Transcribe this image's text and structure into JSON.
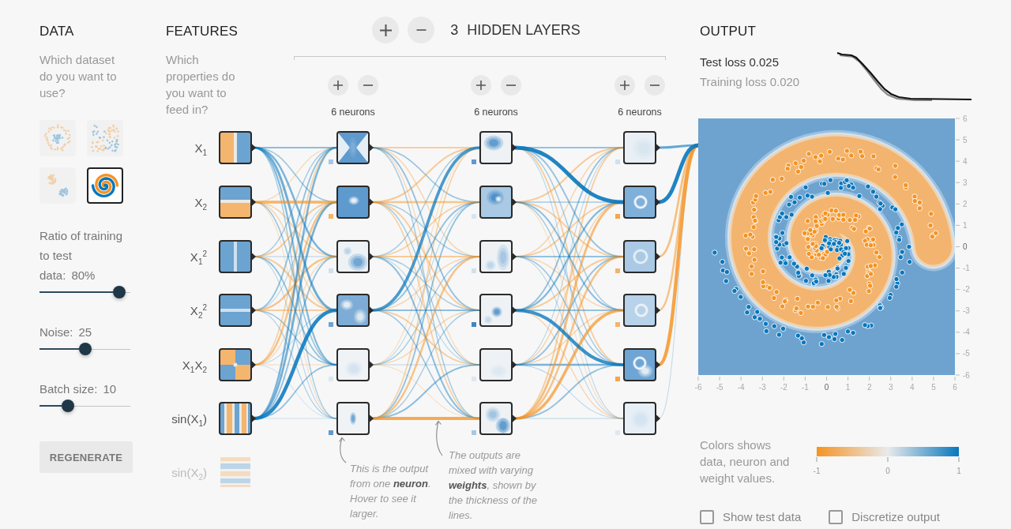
{
  "data": {
    "title": "DATA",
    "description": "Which dataset do you want to use?",
    "datasets": [
      {
        "kind": "circle",
        "selected": false
      },
      {
        "kind": "xor",
        "selected": false
      },
      {
        "kind": "gaussian",
        "selected": false
      },
      {
        "kind": "spiral",
        "selected": true
      }
    ],
    "sliders": [
      {
        "label": "Ratio of training to test data:",
        "value": "80%",
        "level": 0.88
      },
      {
        "label": "Noise:",
        "value": "25",
        "level": 0.5
      },
      {
        "label": "Batch size:",
        "value": "10",
        "level": 0.31
      }
    ],
    "regenerate_button": "REGENERATE"
  },
  "features": {
    "title": "FEATURES",
    "description": "Which properties do you want to feed in?",
    "items": [
      {
        "label": "X$_{1}$",
        "kind": "x1",
        "active": true
      },
      {
        "label": "X$_{2}$",
        "kind": "x2",
        "active": true
      },
      {
        "label": "X$_{1}$$^{2}$",
        "kind": "x1_squared",
        "active": true
      },
      {
        "label": "X$_{2}$$^{2}$",
        "kind": "x2_squared",
        "active": true
      },
      {
        "label": "X$_{1}$X$_{2}$",
        "kind": "x1_times_x2",
        "active": true
      },
      {
        "label": "sin(X$_{1}$)",
        "kind": "sin_x1",
        "active": true
      },
      {
        "label": "sin(X$_{2}$)",
        "kind": "sin_x2",
        "active": false
      }
    ]
  },
  "hidden_layers": {
    "buttons": [
      {
        "kind": "add"
      },
      {
        "kind": "remove"
      }
    ],
    "count": "3",
    "title": "HIDDEN LAYERS",
    "layers": [
      {
        "buttons": [
          {
            "kind": "add"
          },
          {
            "kind": "remove"
          }
        ],
        "neurons": "6 neurons"
      },
      {
        "buttons": [
          {
            "kind": "add"
          },
          {
            "kind": "remove"
          }
        ],
        "neurons": "6 neurons"
      },
      {
        "buttons": [
          {
            "kind": "add"
          },
          {
            "kind": "remove"
          }
        ],
        "neurons": "6 neurons"
      }
    ]
  },
  "annotations": [
    "This is the output from one **neuron**. Hover to see it larger.",
    "The outputs are mixed with varying **weights**, shown by the thickness of the lines."
  ],
  "output": {
    "title": "OUTPUT",
    "test_loss": "Test loss 0.025",
    "training_loss": "Training loss 0.020",
    "plot": {
      "y_axis_labels": [
        "6",
        "5",
        "4",
        "3",
        "2",
        "1",
        "0",
        "-1",
        "-2",
        "-3",
        "-4",
        "-5",
        "-6"
      ],
      "x_axis_labels": [
        "-6",
        "-5",
        "-4",
        "-3",
        "-2",
        "-1",
        "0",
        "1",
        "2",
        "3",
        "4",
        "5",
        "6"
      ]
    },
    "legend": {
      "text": "Colors shows data, neuron and weight values.",
      "scale_labels": [
        "-1",
        "0",
        "1"
      ]
    },
    "checkboxes": [
      {
        "label": "Show test data",
        "checked": false
      },
      {
        "label": "Discretize output",
        "checked": false
      }
    ]
  }
}
